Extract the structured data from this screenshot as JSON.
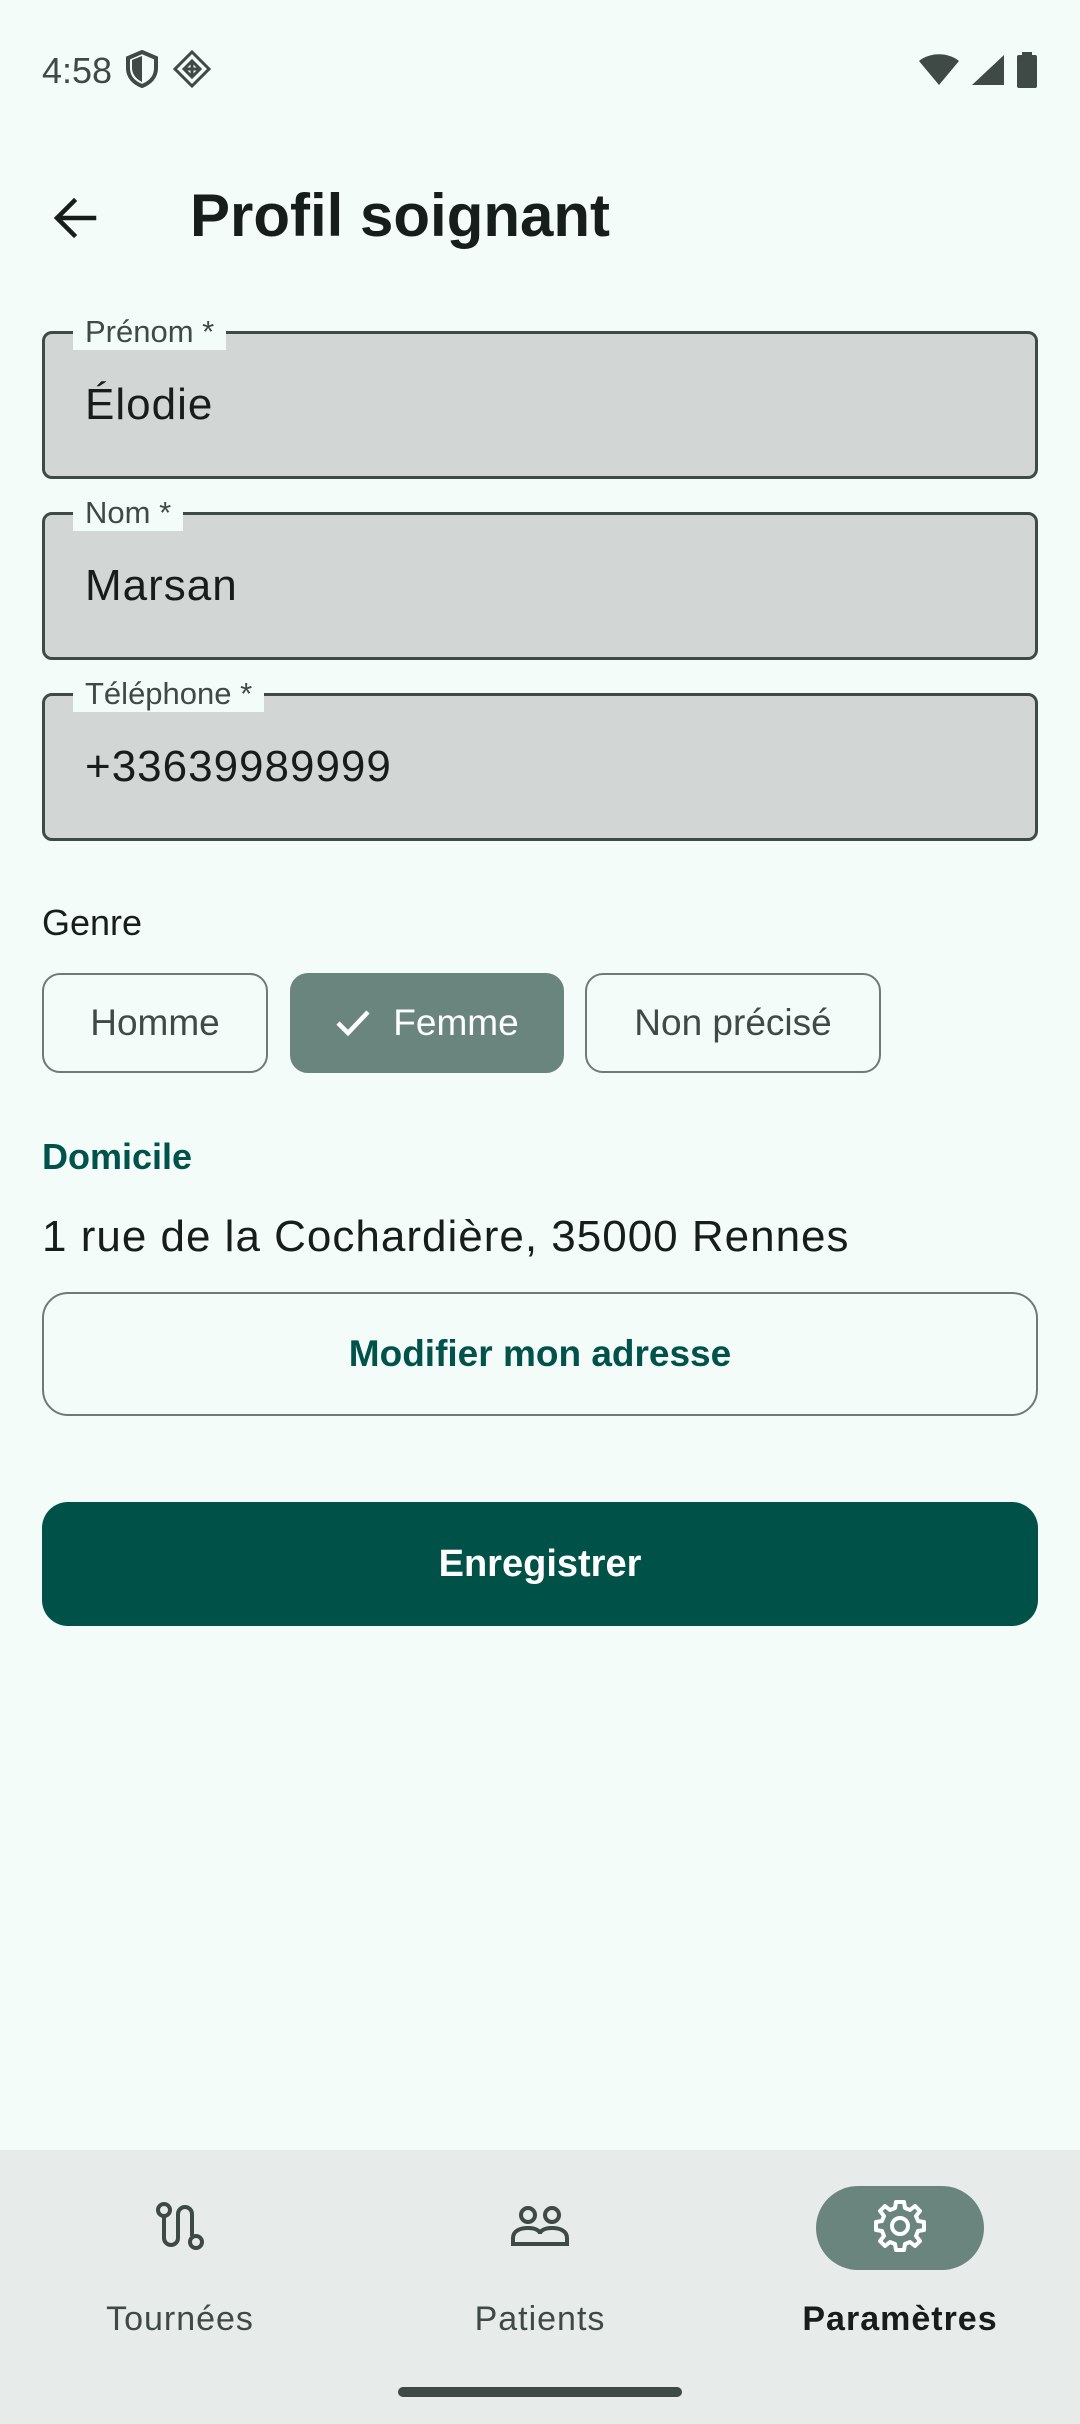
{
  "status_bar": {
    "time": "4:58",
    "left_icons": [
      "shield-icon",
      "diamond-grid-icon"
    ],
    "right_icons": [
      "wifi-icon",
      "signal-icon",
      "battery-icon"
    ]
  },
  "app_bar": {
    "title": "Profil soignant",
    "back_icon": "arrow-back-icon"
  },
  "form": {
    "first_name": {
      "label": "Prénom *",
      "value": "Élodie"
    },
    "last_name": {
      "label": "Nom *",
      "value": "Marsan"
    },
    "phone": {
      "label": "Téléphone *",
      "value": "+33639989999"
    }
  },
  "genre": {
    "label": "Genre",
    "options": [
      {
        "label": "Homme",
        "selected": false
      },
      {
        "label": "Femme",
        "selected": true
      },
      {
        "label": "Non précisé",
        "selected": false
      }
    ]
  },
  "domicile": {
    "label": "Domicile",
    "address": "1 rue de la Cochardière, 35000 Rennes",
    "edit_button": "Modifier mon adresse"
  },
  "save_button": "Enregistrer",
  "bottom_nav": {
    "items": [
      {
        "label": "Tournées",
        "icon": "route-icon",
        "active": false
      },
      {
        "label": "Patients",
        "icon": "people-icon",
        "active": false
      },
      {
        "label": "Paramètres",
        "icon": "gear-icon",
        "active": true
      }
    ]
  },
  "colors": {
    "background": "#f3fcf8",
    "primary": "#005147",
    "selected_chip": "#6a857d",
    "field_fill": "#d2d7d5",
    "nav_background": "#e7ebe9"
  }
}
